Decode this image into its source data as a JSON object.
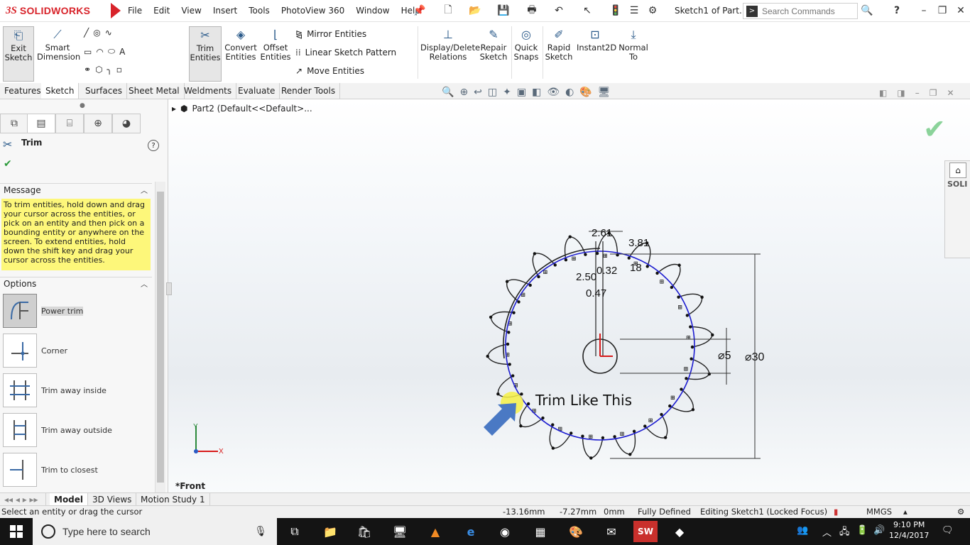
{
  "app": {
    "logo_ds": "3S",
    "logo_name": "SOLIDWORKS",
    "document_title": "Sketch1 of Part...",
    "search_placeholder": "Search Commands",
    "help_glyph": "?"
  },
  "menu": [
    "File",
    "Edit",
    "View",
    "Insert",
    "Tools",
    "PhotoView 360",
    "Window",
    "Help"
  ],
  "commands": {
    "exit_sketch": "Exit\nSketch",
    "smart_dimension": "Smart\nDimension",
    "trim_entities": "Trim\nEntities",
    "convert_entities": "Convert\nEntities",
    "offset_entities": "Offset\nEntities",
    "mirror_entities": "Mirror Entities",
    "linear_sketch_pattern": "Linear Sketch Pattern",
    "move_entities": "Move Entities",
    "display_delete_relations": "Display/Delete\nRelations",
    "repair_sketch": "Repair\nSketch",
    "quick_snaps": "Quick\nSnaps",
    "rapid_sketch": "Rapid\nSketch",
    "instant2d": "Instant2D",
    "normal_to": "Normal\nTo"
  },
  "tabs": [
    "Features",
    "Sketch",
    "Surfaces",
    "Sheet Metal",
    "Weldments",
    "Evaluate",
    "Render Tools"
  ],
  "active_tab": "Sketch",
  "property_manager": {
    "title": "Trim",
    "help": "?",
    "message_header": "Message",
    "message": "To trim entities, hold down and drag your cursor across the entities, or pick on an entity and then pick on a bounding entity or anywhere on the screen.  To extend entities, hold down the shift key and drag your cursor across the entities.",
    "options_header": "Options",
    "options": [
      "Power trim",
      "Corner",
      "Trim away inside",
      "Trim away outside",
      "Trim to closest"
    ],
    "selected_option": "Power trim"
  },
  "tree": {
    "part": "Part2  (Default<<Default>..."
  },
  "viewport": {
    "view_label": "*Front",
    "annotation": "Trim Like This",
    "axis_x": "X",
    "axis_y": "Y"
  },
  "dimensions": {
    "d1": "2.61",
    "d2": "3.81",
    "d3": "2.50",
    "d4": "0.32",
    "d5": "18",
    "d6": "0.47",
    "hole_dia": "⌀5",
    "outer_dia": "⌀30"
  },
  "model_tabs": [
    "Model",
    "3D Views",
    "Motion Study 1"
  ],
  "active_model_tab": "Model",
  "status": {
    "hint": "Select an entity or drag the cursor",
    "x": "-13.16mm",
    "y": "-7.27mm",
    "z": "0mm",
    "state": "Fully Defined",
    "editing": "Editing Sketch1 (Locked Focus)",
    "units": "MMGS"
  },
  "taskbar": {
    "search_text": "Type here to search",
    "time": "9:10 PM",
    "date": "12/4/2017"
  },
  "colors": {
    "brand_red": "#d8232a",
    "message_yellow": "#fdf77a",
    "sketch_blue": "#1b1bcf",
    "arrow_blue": "#4a79c4"
  }
}
